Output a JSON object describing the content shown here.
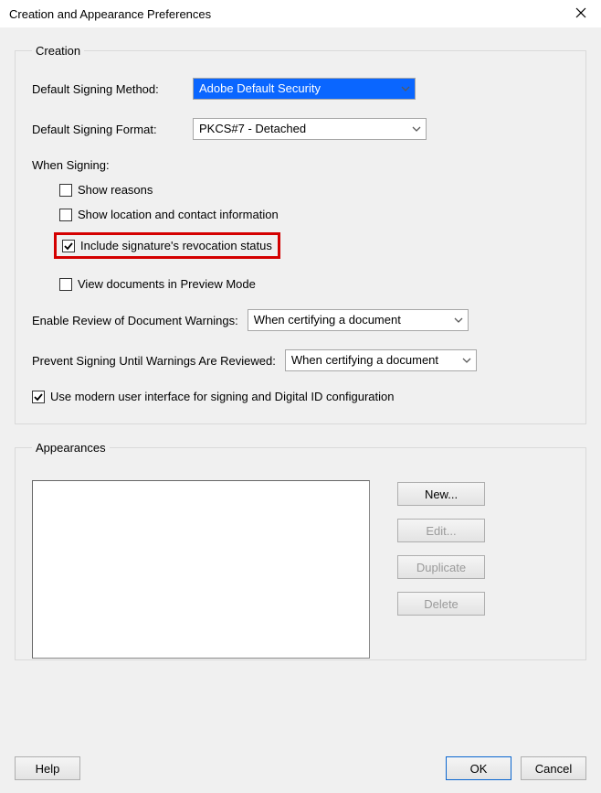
{
  "window": {
    "title": "Creation and Appearance Preferences"
  },
  "creation": {
    "legend": "Creation",
    "default_method_label": "Default Signing Method:",
    "default_method_value": "Adobe Default Security",
    "default_format_label": "Default Signing Format:",
    "default_format_value": "PKCS#7 - Detached",
    "when_signing_label": "When Signing:",
    "options": {
      "show_reasons": {
        "label": "Show reasons",
        "checked": false
      },
      "show_location": {
        "label": "Show location and contact information",
        "checked": false
      },
      "include_revocation": {
        "label": "Include signature's revocation status",
        "checked": true
      },
      "view_preview": {
        "label": "View documents in Preview Mode",
        "checked": false
      }
    },
    "review_warnings_label": "Enable Review of Document Warnings:",
    "review_warnings_value": "When certifying a document",
    "prevent_signing_label": "Prevent Signing Until Warnings Are Reviewed:",
    "prevent_signing_value": "When certifying a document",
    "modern_ui": {
      "label": "Use modern user interface for signing and Digital ID configuration",
      "checked": true
    }
  },
  "appearances": {
    "legend": "Appearances",
    "items": [],
    "buttons": {
      "new": "New...",
      "edit": "Edit...",
      "duplicate": "Duplicate",
      "delete": "Delete"
    }
  },
  "footer": {
    "help": "Help",
    "ok": "OK",
    "cancel": "Cancel"
  }
}
